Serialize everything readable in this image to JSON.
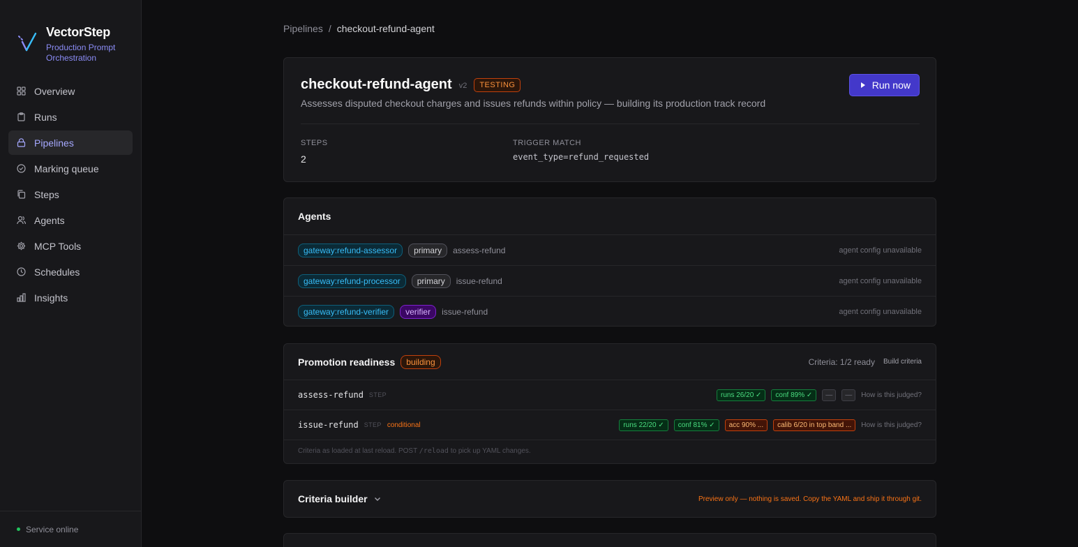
{
  "brand": {
    "name": "VectorStep",
    "subtitle_line1": "Production Prompt",
    "subtitle_line2": "Orchestration"
  },
  "nav": {
    "items": [
      {
        "label": "Overview",
        "icon": "grid-icon"
      },
      {
        "label": "Runs",
        "icon": "clipboard-icon"
      },
      {
        "label": "Pipelines",
        "icon": "lock-icon",
        "active": true
      },
      {
        "label": "Marking queue",
        "icon": "check-circle-icon"
      },
      {
        "label": "Steps",
        "icon": "copy-icon"
      },
      {
        "label": "Agents",
        "icon": "users-icon"
      },
      {
        "label": "MCP Tools",
        "icon": "gear-icon"
      },
      {
        "label": "Schedules",
        "icon": "clock-icon"
      },
      {
        "label": "Insights",
        "icon": "bar-chart-icon"
      }
    ]
  },
  "footer": {
    "status": "Service online"
  },
  "breadcrumb": {
    "root": "Pipelines",
    "separator": "/",
    "current": "checkout-refund-agent"
  },
  "pipeline": {
    "name": "checkout-refund-agent",
    "version": "v2",
    "status": "TESTING",
    "description": "Assesses disputed checkout charges and issues refunds within policy — building its production track record",
    "run_label": "Run now",
    "steps_label": "STEPS",
    "steps_value": "2",
    "trigger_label": "TRIGGER MATCH",
    "trigger_value": "event_type=refund_requested"
  },
  "agents": {
    "title": "Agents",
    "rows": [
      {
        "gateway": "gateway:refund-assessor",
        "role": "primary",
        "step": "assess-refund",
        "note": "agent config unavailable"
      },
      {
        "gateway": "gateway:refund-processor",
        "role": "primary",
        "step": "issue-refund",
        "note": "agent config unavailable"
      },
      {
        "gateway": "gateway:refund-verifier",
        "role": "verifier",
        "step": "issue-refund",
        "note": "agent config unavailable"
      }
    ]
  },
  "promotion": {
    "title": "Promotion readiness",
    "status": "building",
    "criteria_count": "Criteria: 1/2 ready",
    "build_link": "Build criteria",
    "steps": [
      {
        "name": "assess-refund",
        "kind": "STEP",
        "conditional": "",
        "chips": [
          {
            "text": "runs 26/20 ✓",
            "state": "ok"
          },
          {
            "text": "conf 89% ✓",
            "state": "ok"
          },
          {
            "text": "—",
            "state": "na"
          },
          {
            "text": "—",
            "state": "na"
          }
        ],
        "judged": "How is this judged?"
      },
      {
        "name": "issue-refund",
        "kind": "STEP",
        "conditional": "conditional",
        "chips": [
          {
            "text": "runs 22/20 ✓",
            "state": "ok"
          },
          {
            "text": "conf 81% ✓",
            "state": "ok"
          },
          {
            "text": "acc 90% ...",
            "state": "warn"
          },
          {
            "text": "calib 6/20 in top band ...",
            "state": "warn"
          }
        ],
        "judged": "How is this judged?"
      }
    ],
    "note_prefix": "Criteria as loaded at last reload. POST ",
    "note_code": "/reload",
    "note_suffix": " to pick up YAML changes."
  },
  "builder": {
    "title": "Criteria builder",
    "note": "Preview only — nothing is saved. Copy the YAML and ship it through git."
  },
  "colors": {
    "accent": "#4338ca",
    "active_nav": "#a5a8ff",
    "ok": "#4ade80",
    "warn": "#fb923c",
    "online": "#22c55e"
  }
}
